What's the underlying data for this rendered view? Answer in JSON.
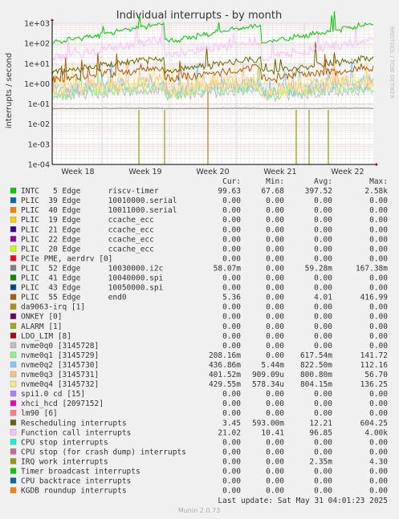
{
  "chart_data": {
    "type": "line",
    "title": "Individual interrupts - by month",
    "ylabel": "interrupts / second",
    "yscale": "log",
    "ylim": [
      0.0001,
      1000
    ],
    "yticks": [
      "1e+03",
      "1e+02",
      "1e+01",
      "1e+00",
      "1e-01",
      "1e-02",
      "1e-03",
      "1e-04"
    ],
    "xticks": [
      "Week 18",
      "Week 19",
      "Week 20",
      "Week 21",
      "Week 22"
    ],
    "grid": true,
    "side_label": "RRDTOOL / TOBI OETIKER",
    "table_header": [
      "Cur:",
      "Min:",
      "Avg:",
      "Max:"
    ],
    "series": [
      {
        "label": "INTC   5 Edge      riscv-timer",
        "color": "#00cc00",
        "cur": "99.63",
        "min": "67.68",
        "avg": "397.52",
        "max": "2.58k"
      },
      {
        "label": "PLIC  39 Edge      10010000.serial",
        "color": "#0066b3",
        "cur": "0.00",
        "min": "0.00",
        "avg": "0.00",
        "max": "0.00"
      },
      {
        "label": "PLIC  40 Edge      10011000.serial",
        "color": "#ff8000",
        "cur": "0.00",
        "min": "0.00",
        "avg": "0.00",
        "max": "0.00"
      },
      {
        "label": "PLIC  19 Edge      ccache_ecc",
        "color": "#ffcc00",
        "cur": "0.00",
        "min": "0.00",
        "avg": "0.00",
        "max": "0.00"
      },
      {
        "label": "PLIC  21 Edge      ccache_ecc",
        "color": "#330099",
        "cur": "0.00",
        "min": "0.00",
        "avg": "0.00",
        "max": "0.00"
      },
      {
        "label": "PLIC  22 Edge      ccache_ecc",
        "color": "#990099",
        "cur": "0.00",
        "min": "0.00",
        "avg": "0.00",
        "max": "0.00"
      },
      {
        "label": "PLIC  20 Edge      ccache_ecc",
        "color": "#ccff00",
        "cur": "0.00",
        "min": "0.00",
        "avg": "0.00",
        "max": "0.00"
      },
      {
        "label": "PCIe PME, aerdrv [0]",
        "color": "#ff0000",
        "cur": "0.00",
        "min": "0.00",
        "avg": "0.00",
        "max": "0.00"
      },
      {
        "label": "PLIC  52 Edge      10030000.i2c",
        "color": "#808080",
        "cur": "58.07m",
        "min": "0.00",
        "avg": "59.28m",
        "max": "167.38m"
      },
      {
        "label": "PLIC  41 Edge      10040000.spi",
        "color": "#008f00",
        "cur": "0.00",
        "min": "0.00",
        "avg": "0.00",
        "max": "0.00"
      },
      {
        "label": "PLIC  43 Edge      10050000.spi",
        "color": "#00487d",
        "cur": "0.00",
        "min": "0.00",
        "avg": "0.00",
        "max": "0.00"
      },
      {
        "label": "PLIC  55 Edge      end0",
        "color": "#b35a00",
        "cur": "5.36",
        "min": "0.00",
        "avg": "4.01",
        "max": "416.99"
      },
      {
        "label": "da9063-irq [1]",
        "color": "#b38f00",
        "cur": "0.00",
        "min": "0.00",
        "avg": "0.00",
        "max": "0.00"
      },
      {
        "label": "ONKEY [0]",
        "color": "#6b006b",
        "cur": "0.00",
        "min": "0.00",
        "avg": "0.00",
        "max": "0.00"
      },
      {
        "label": "ALARM [1]",
        "color": "#8fb300",
        "cur": "0.00",
        "min": "0.00",
        "avg": "0.00",
        "max": "0.00"
      },
      {
        "label": "LDO_LIM [8]",
        "color": "#b30000",
        "cur": "0.00",
        "min": "0.00",
        "avg": "0.00",
        "max": "0.00"
      },
      {
        "label": "nvme0q0 [3145728]",
        "color": "#bebebe",
        "cur": "0.00",
        "min": "0.00",
        "avg": "0.00",
        "max": "0.00"
      },
      {
        "label": "nvme0q1 [3145729]",
        "color": "#80ff80",
        "cur": "208.16m",
        "min": "0.00",
        "avg": "617.54m",
        "max": "141.72"
      },
      {
        "label": "nvme0q2 [3145730]",
        "color": "#80c9ff",
        "cur": "436.86m",
        "min": "5.44m",
        "avg": "822.50m",
        "max": "112.16"
      },
      {
        "label": "nvme0q3 [3145731]",
        "color": "#ffc080",
        "cur": "401.52m",
        "min": "909.09u",
        "avg": "800.80m",
        "max": "56.70"
      },
      {
        "label": "nvme0q4 [3145732]",
        "color": "#ffe680",
        "cur": "429.55m",
        "min": "578.34u",
        "avg": "804.15m",
        "max": "136.25"
      },
      {
        "label": "spi1.0 cd [15]",
        "color": "#aa80ff",
        "cur": "0.00",
        "min": "0.00",
        "avg": "0.00",
        "max": "0.00"
      },
      {
        "label": "xhci_hcd [2097152]",
        "color": "#ee00cc",
        "cur": "0.00",
        "min": "0.00",
        "avg": "0.00",
        "max": "0.00"
      },
      {
        "label": "lm90 [6]",
        "color": "#ff8080",
        "cur": "0.00",
        "min": "0.00",
        "avg": "0.00",
        "max": "0.00"
      },
      {
        "label": "Rescheduling interrupts",
        "color": "#666600",
        "cur": "3.45",
        "min": "593.00m",
        "avg": "12.21",
        "max": "604.25"
      },
      {
        "label": "Function call interrupts",
        "color": "#ffbfff",
        "cur": "21.02",
        "min": "10.41",
        "avg": "96.85",
        "max": "4.00k"
      },
      {
        "label": "CPU stop interrupts",
        "color": "#00ffcc",
        "cur": "0.00",
        "min": "0.00",
        "avg": "0.00",
        "max": "0.00"
      },
      {
        "label": "CPU stop (for crash dump) interrupts",
        "color": "#cc6699",
        "cur": "0.00",
        "min": "0.00",
        "avg": "0.00",
        "max": "0.00"
      },
      {
        "label": "IRQ work interrupts",
        "color": "#999900",
        "cur": "0.00",
        "min": "0.00",
        "avg": "2.35m",
        "max": "4.30"
      },
      {
        "label": "Timer broadcast interrupts",
        "color": "#00cc00",
        "cur": "0.00",
        "min": "0.00",
        "avg": "0.00",
        "max": "0.00"
      },
      {
        "label": "CPU backtrace interrupts",
        "color": "#0066b3",
        "cur": "0.00",
        "min": "0.00",
        "avg": "0.00",
        "max": "0.00"
      },
      {
        "label": "KGDB roundup interrupts",
        "color": "#ff8000",
        "cur": "0.00",
        "min": "0.00",
        "avg": "0.00",
        "max": "0.00"
      }
    ],
    "last_update": "Last update: Sat May 31 04:01:23 2025",
    "footer": "Munin 2.0.73"
  }
}
